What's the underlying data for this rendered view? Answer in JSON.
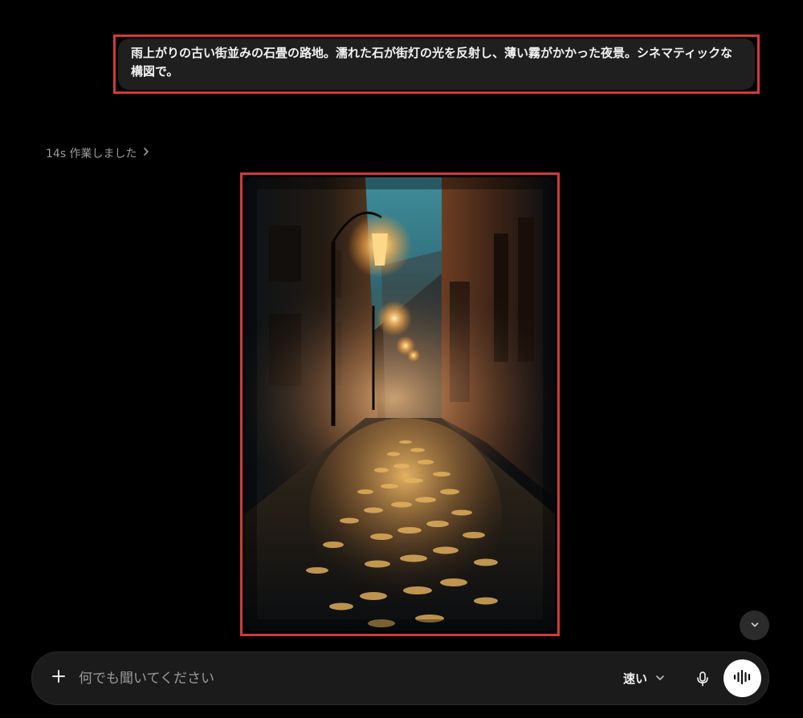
{
  "user_message": {
    "text": "雨上がりの古い街並みの石畳の路地。濡れた石が街灯の光を反射し、薄い霧がかかった夜景。シネマティックな構図で。"
  },
  "assistant": {
    "worked_label": "14s 作業しました"
  },
  "composer": {
    "placeholder": "何でも聞いてください",
    "model_label": "速い"
  },
  "icons": {
    "plus": "plus-icon",
    "chevron_right": "chevron-right-icon",
    "chevron_down": "chevron-down-icon",
    "mic": "microphone-icon",
    "voice": "voice-waveform-icon",
    "scroll_down": "arrow-down-icon"
  },
  "colors": {
    "background": "#000000",
    "bubble": "#1f1f1f",
    "composer": "#1b1b1b",
    "highlight": "#d23a3a"
  }
}
